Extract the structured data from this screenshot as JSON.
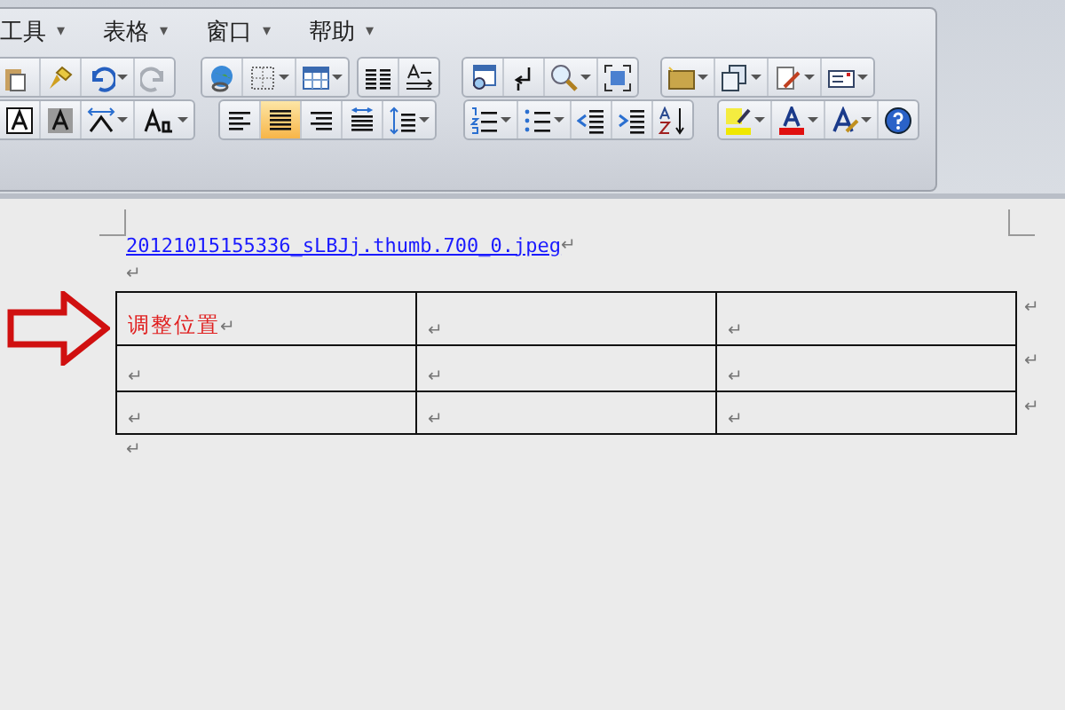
{
  "menu_bar": [
    {
      "label": "工具",
      "caret": "▾"
    },
    {
      "label": "表格",
      "caret": "▾"
    },
    {
      "label": "窗口",
      "caret": "▾"
    },
    {
      "label": "帮助",
      "caret": "▾"
    }
  ],
  "alignment_buttons": [
    {
      "selected": false
    },
    {
      "selected": true
    },
    {
      "selected": false
    },
    {
      "selected": false
    }
  ],
  "document": {
    "link": "20121015155336_sLBJj.thumb.700_0.jpeg",
    "link_mark": "↵",
    "empty_paragraph": "↵",
    "table": {
      "rows": [
        {
          "cells": [
            {
              "text": "调整位置",
              "mark": "↵"
            },
            {
              "mark": "↵"
            },
            {
              "mark": "↵"
            }
          ],
          "end_mark": "↵"
        },
        {
          "cells": [
            {
              "mark": "↵"
            },
            {
              "mark": "↵"
            },
            {
              "mark": "↵"
            }
          ],
          "end_mark": "↵"
        },
        {
          "cells": [
            {
              "mark": "↵"
            },
            {
              "mark": "↵"
            },
            {
              "mark": "↵"
            }
          ],
          "end_mark": "↵"
        }
      ]
    },
    "after_table": "↵"
  }
}
